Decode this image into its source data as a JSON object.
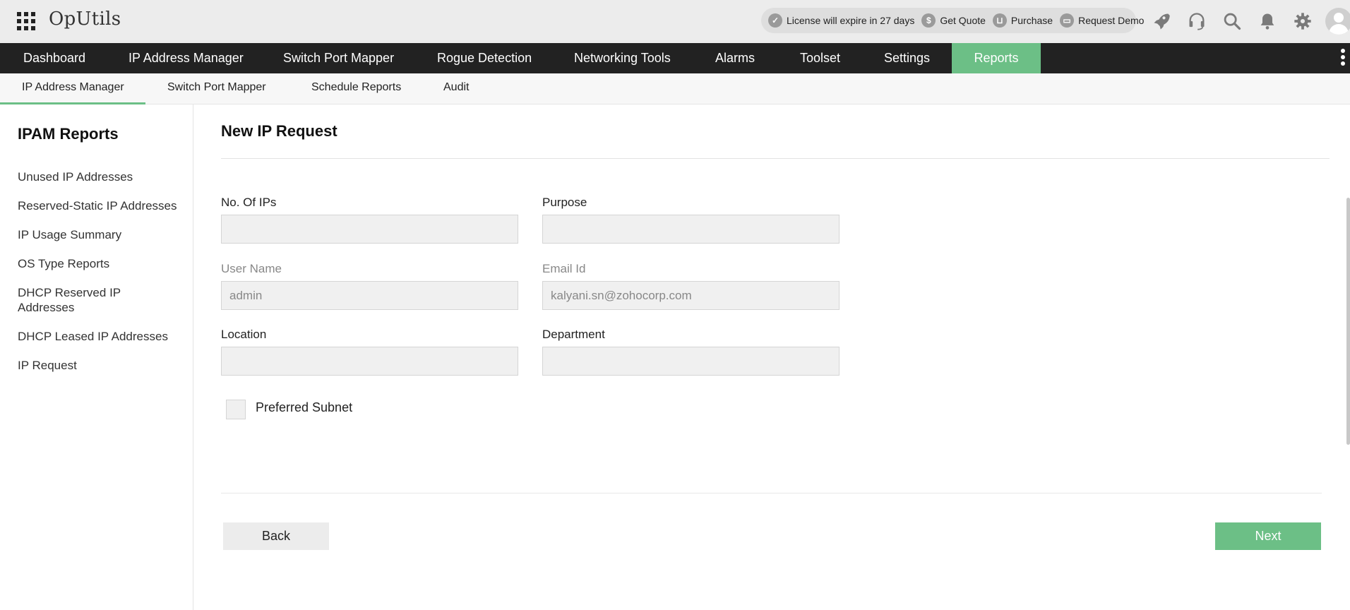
{
  "header": {
    "brand": "OpUtils",
    "license_text": "License will expire in 27 days",
    "get_quote": "Get Quote",
    "purchase": "Purchase",
    "request_demo": "Request Demo",
    "icons": [
      "apps-grid-icon",
      "rocket-icon",
      "headset-icon",
      "search-icon",
      "bell-icon",
      "gear-icon",
      "avatar"
    ]
  },
  "main_nav": {
    "items": [
      "Dashboard",
      "IP Address Manager",
      "Switch Port Mapper",
      "Rogue Detection",
      "Networking Tools",
      "Alarms",
      "Toolset",
      "Settings",
      "Reports"
    ],
    "active": "Reports"
  },
  "sub_nav": {
    "items": [
      "IP Address Manager",
      "Switch Port Mapper",
      "Schedule Reports",
      "Audit"
    ],
    "active": "IP Address Manager"
  },
  "sidebar": {
    "title": "IPAM Reports",
    "items": [
      "Unused IP Addresses",
      "Reserved-Static IP Addresses",
      "IP Usage Summary",
      "OS Type Reports",
      "DHCP Reserved IP Addresses",
      "DHCP Leased IP Addresses",
      "IP Request"
    ]
  },
  "form": {
    "title": "New IP Request",
    "no_of_ips_label": "No. Of IPs",
    "no_of_ips_value": "",
    "purpose_label": "Purpose",
    "purpose_value": "",
    "user_name_label": "User Name",
    "user_name_value": "admin",
    "email_label": "Email Id",
    "email_value": "kalyani.sn@zohocorp.com",
    "location_label": "Location",
    "location_value": "",
    "department_label": "Department",
    "department_value": "",
    "preferred_subnet_label": "Preferred Subnet",
    "preferred_subnet_checked": false,
    "back_label": "Back",
    "next_label": "Next"
  },
  "colors": {
    "accent": "#6cbf86",
    "nav_bg": "#222222",
    "header_bg": "#ececec"
  }
}
